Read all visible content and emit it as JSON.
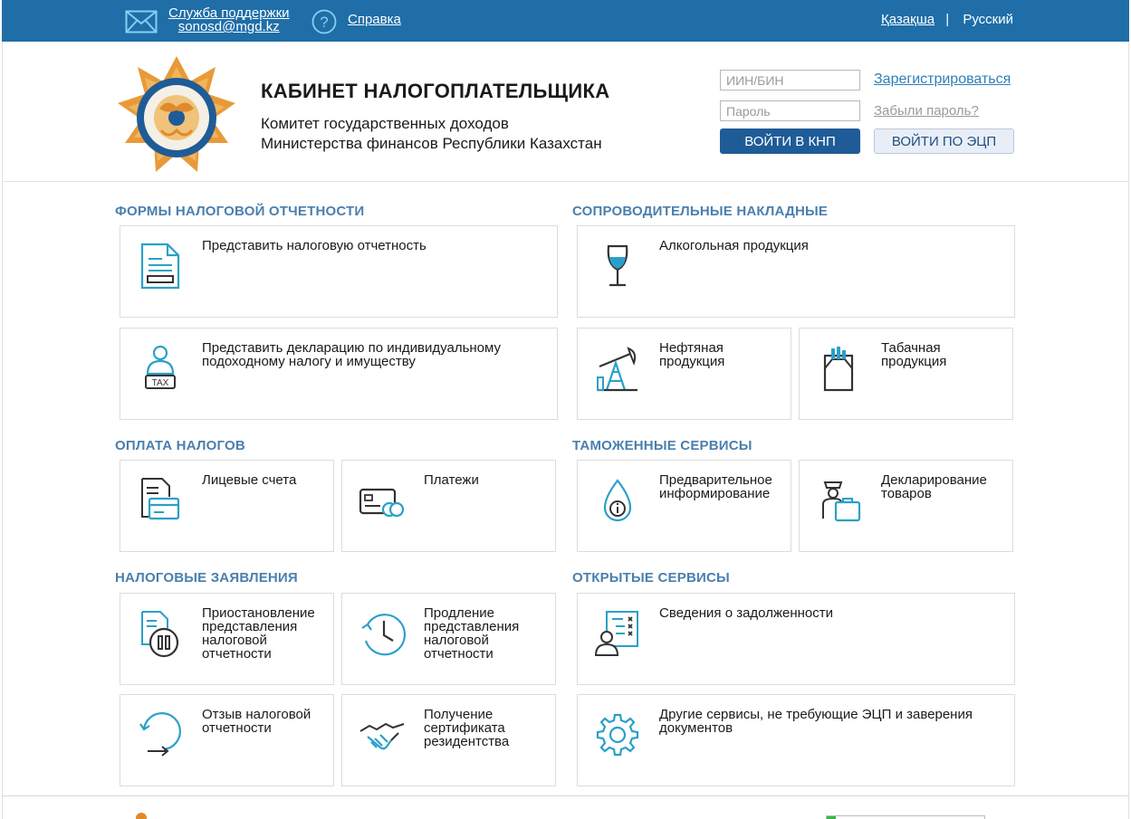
{
  "topbar": {
    "support_label": "Служба поддержки",
    "support_email": "sonosd@mgd.kz",
    "help_label": "Справка",
    "lang_kz": "Қазақша",
    "lang_sep": "|",
    "lang_ru": "Русский"
  },
  "header": {
    "title": "КАБИНЕТ НАЛОГОПЛАТЕЛЬЩИКА",
    "subtitle_line1": "Комитет государственных доходов",
    "subtitle_line2": "Министерства финансов Республики Казахстан"
  },
  "login": {
    "iin_placeholder": "ИИН/БИН",
    "password_placeholder": "Пароль",
    "register_link": "Зарегистрироваться",
    "forgot_link": "Забыли пароль?",
    "login_knp_button": "ВОЙТИ В КНП",
    "login_ecp_button": "ВОЙТИ ПО ЭЦП"
  },
  "sections": {
    "tax_reports": {
      "title": "ФОРМЫ НАЛОГОВОЙ ОТЧЕТНОСТИ",
      "submit_report": "Представить налоговую отчетность",
      "submit_declaration": "Представить декларацию по индивидуальному подоходному налогу и имуществу"
    },
    "waybills": {
      "title": "СОПРОВОДИТЕЛЬНЫЕ НАКЛАДНЫЕ",
      "alcohol": "Алкогольная продукция",
      "oil": "Нефтяная продукция",
      "tobacco": "Табачная продукция"
    },
    "tax_payment": {
      "title": "ОПЛАТА НАЛОГОВ",
      "accounts": "Лицевые счета",
      "payments": "Платежи"
    },
    "customs": {
      "title": "ТАМОЖЕННЫЕ СЕРВИСЫ",
      "pre_info": "Предварительное информирование",
      "goods_declaration": "Декларирование товаров"
    },
    "tax_applications": {
      "title": "НАЛОГОВЫЕ ЗАЯВЛЕНИЯ",
      "suspension": "Приостановление представления налоговой отчетности",
      "extension": "Продление представления налоговой отчетности",
      "withdrawal": "Отзыв налоговой отчетности",
      "residency": "Получение сертификата резидентства"
    },
    "open_services": {
      "title": "ОТКРЫТЫЕ СЕРВИСЫ",
      "debt_info": "Сведения о задолженности",
      "other_services": "Другие сервисы, не требующие ЭЦП и заверения документов"
    }
  },
  "colors": {
    "topbar": "#1f6ea8",
    "section_title": "#4a7fae",
    "icon_blue": "#2aa0c8",
    "primary_button": "#1f5c97",
    "logo_orange": "#e08a2b"
  }
}
